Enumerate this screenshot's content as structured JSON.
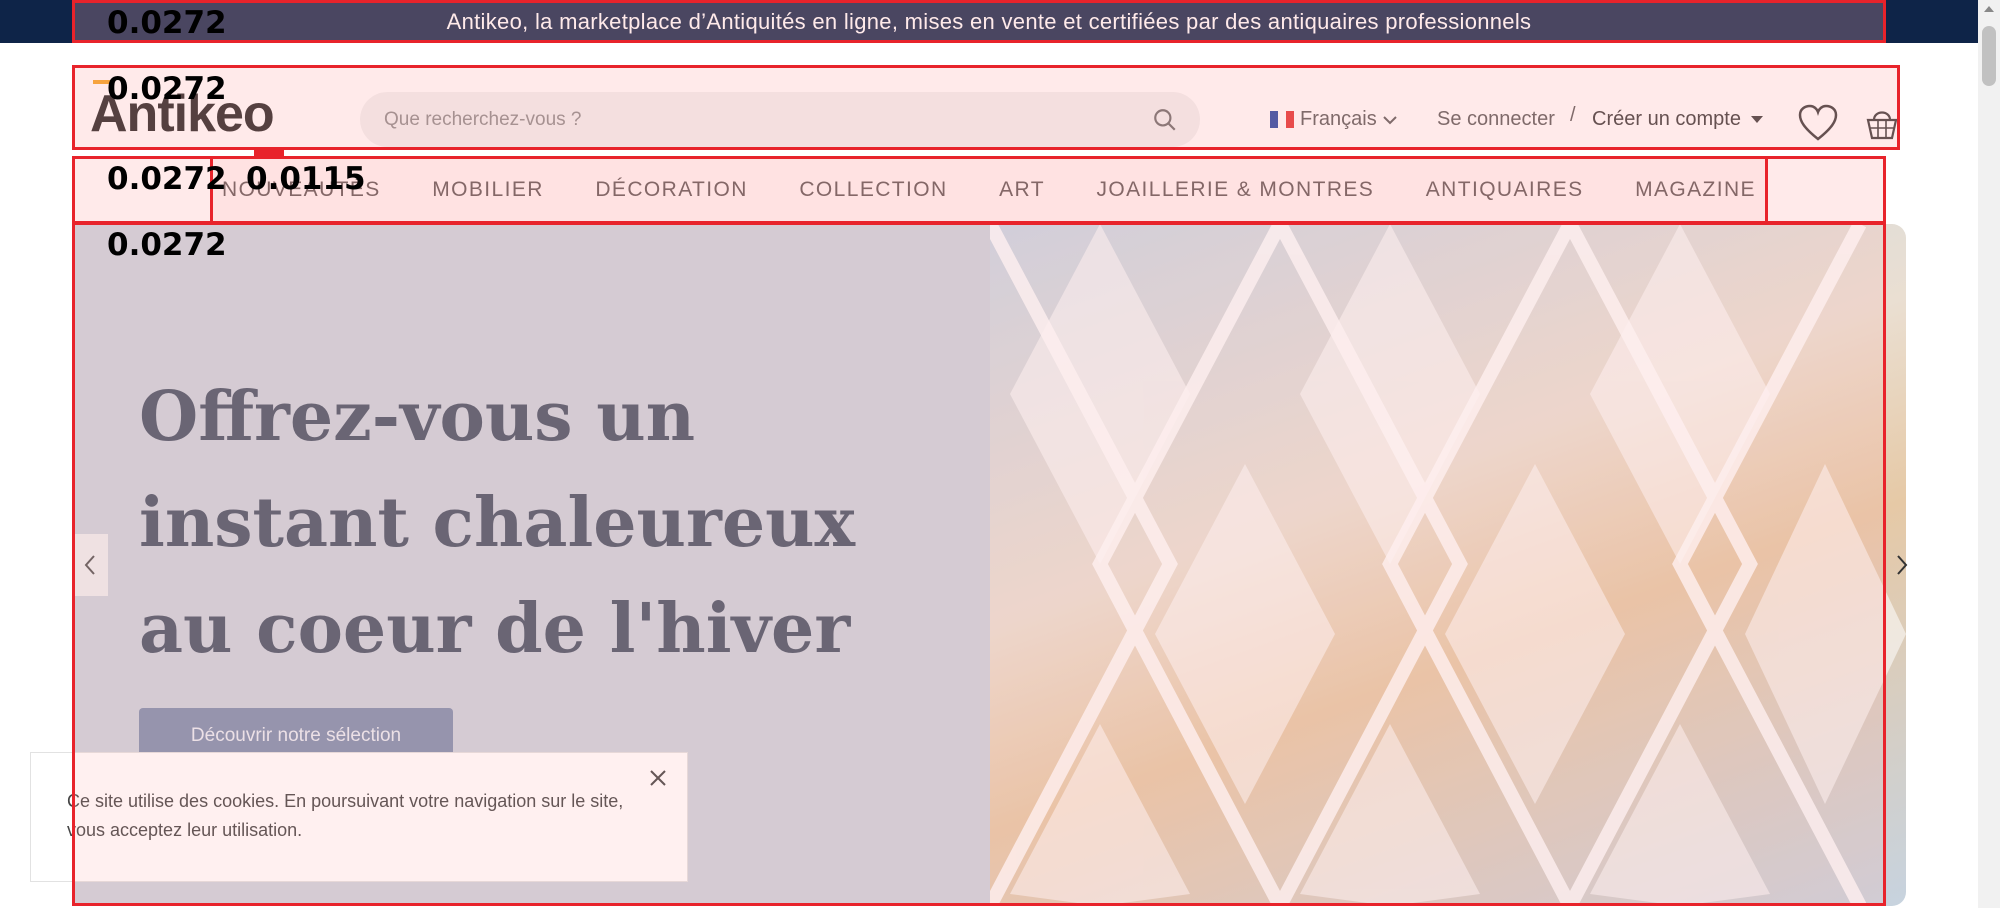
{
  "topbar": {
    "message": "Antikeo, la marketplace d’Antiquités en ligne, mises en vente et certifiées par des antiquaires professionnels"
  },
  "header": {
    "logo_text": "Antikeo",
    "search_placeholder": "Que recherchez-vous ?",
    "language": "Français",
    "login": "Se connecter",
    "separator": "/",
    "signup": "Créer un compte"
  },
  "nav": {
    "items": [
      {
        "label": "NOUVEAUTÉS"
      },
      {
        "label": "MOBILIER"
      },
      {
        "label": "DÉCORATION"
      },
      {
        "label": "COLLECTION"
      },
      {
        "label": "ART"
      },
      {
        "label": "JOAILLERIE & MONTRES"
      },
      {
        "label": "ANTIQUAIRES"
      },
      {
        "label": "MAGAZINE"
      }
    ]
  },
  "hero": {
    "title": "Offrez-vous un instant chaleureux au coeur de l'hiver",
    "cta": "Découvrir notre sélection"
  },
  "cookie": {
    "text": "Ce site utilise des cookies. En poursuivant votre navigation sur le site, vous acceptez leur utilisation."
  },
  "overlay_scores": {
    "topbar": "0.0272",
    "header": "0.0272",
    "nav": "0.0272",
    "nav_inner": "0.0115",
    "hero": "0.0272"
  },
  "colors": {
    "topbar_bg": "#0e2448",
    "overlay_red": "#e8232b",
    "cta_bg": "#7f8fae",
    "hero_text": "#4a5668",
    "logo_accent": "#f3a11a"
  }
}
